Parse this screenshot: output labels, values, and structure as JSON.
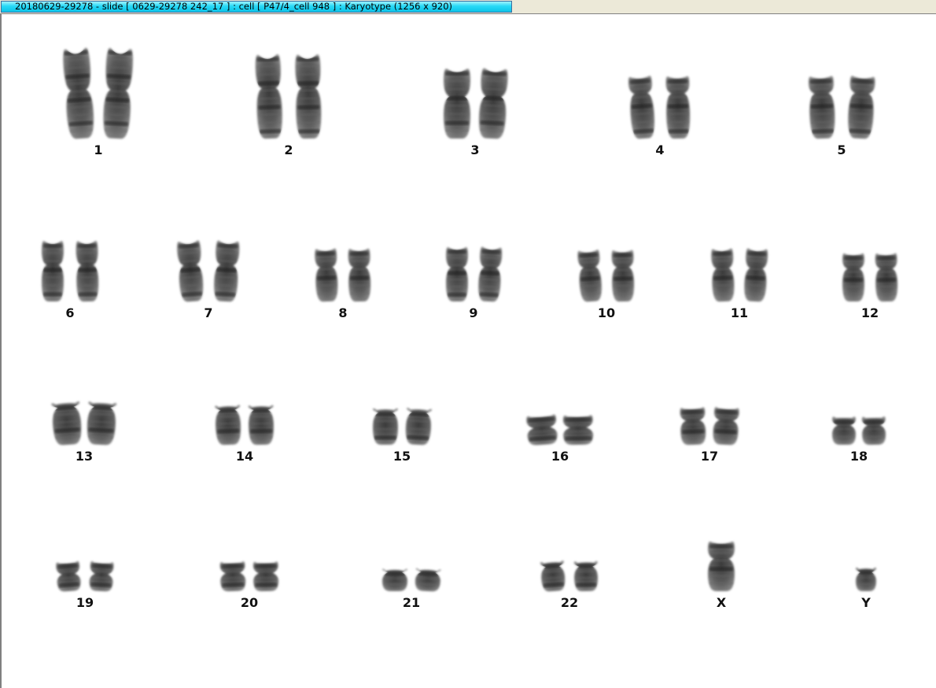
{
  "window": {
    "title": "20180629-29278 - slide [ 0629-29278 242_17 ] : cell [ P47/4_cell 948 ] : Karyotype  (1256 x 920)"
  },
  "karyotype": {
    "chromosomes": [
      {
        "label": "1"
      },
      {
        "label": "2"
      },
      {
        "label": "3"
      },
      {
        "label": "4"
      },
      {
        "label": "5"
      },
      {
        "label": "6"
      },
      {
        "label": "7"
      },
      {
        "label": "8"
      },
      {
        "label": "9"
      },
      {
        "label": "10"
      },
      {
        "label": "11"
      },
      {
        "label": "12"
      },
      {
        "label": "13"
      },
      {
        "label": "14"
      },
      {
        "label": "15"
      },
      {
        "label": "16"
      },
      {
        "label": "17"
      },
      {
        "label": "18"
      },
      {
        "label": "19"
      },
      {
        "label": "20"
      },
      {
        "label": "21"
      },
      {
        "label": "22"
      },
      {
        "label": "X"
      },
      {
        "label": "Y"
      }
    ]
  }
}
